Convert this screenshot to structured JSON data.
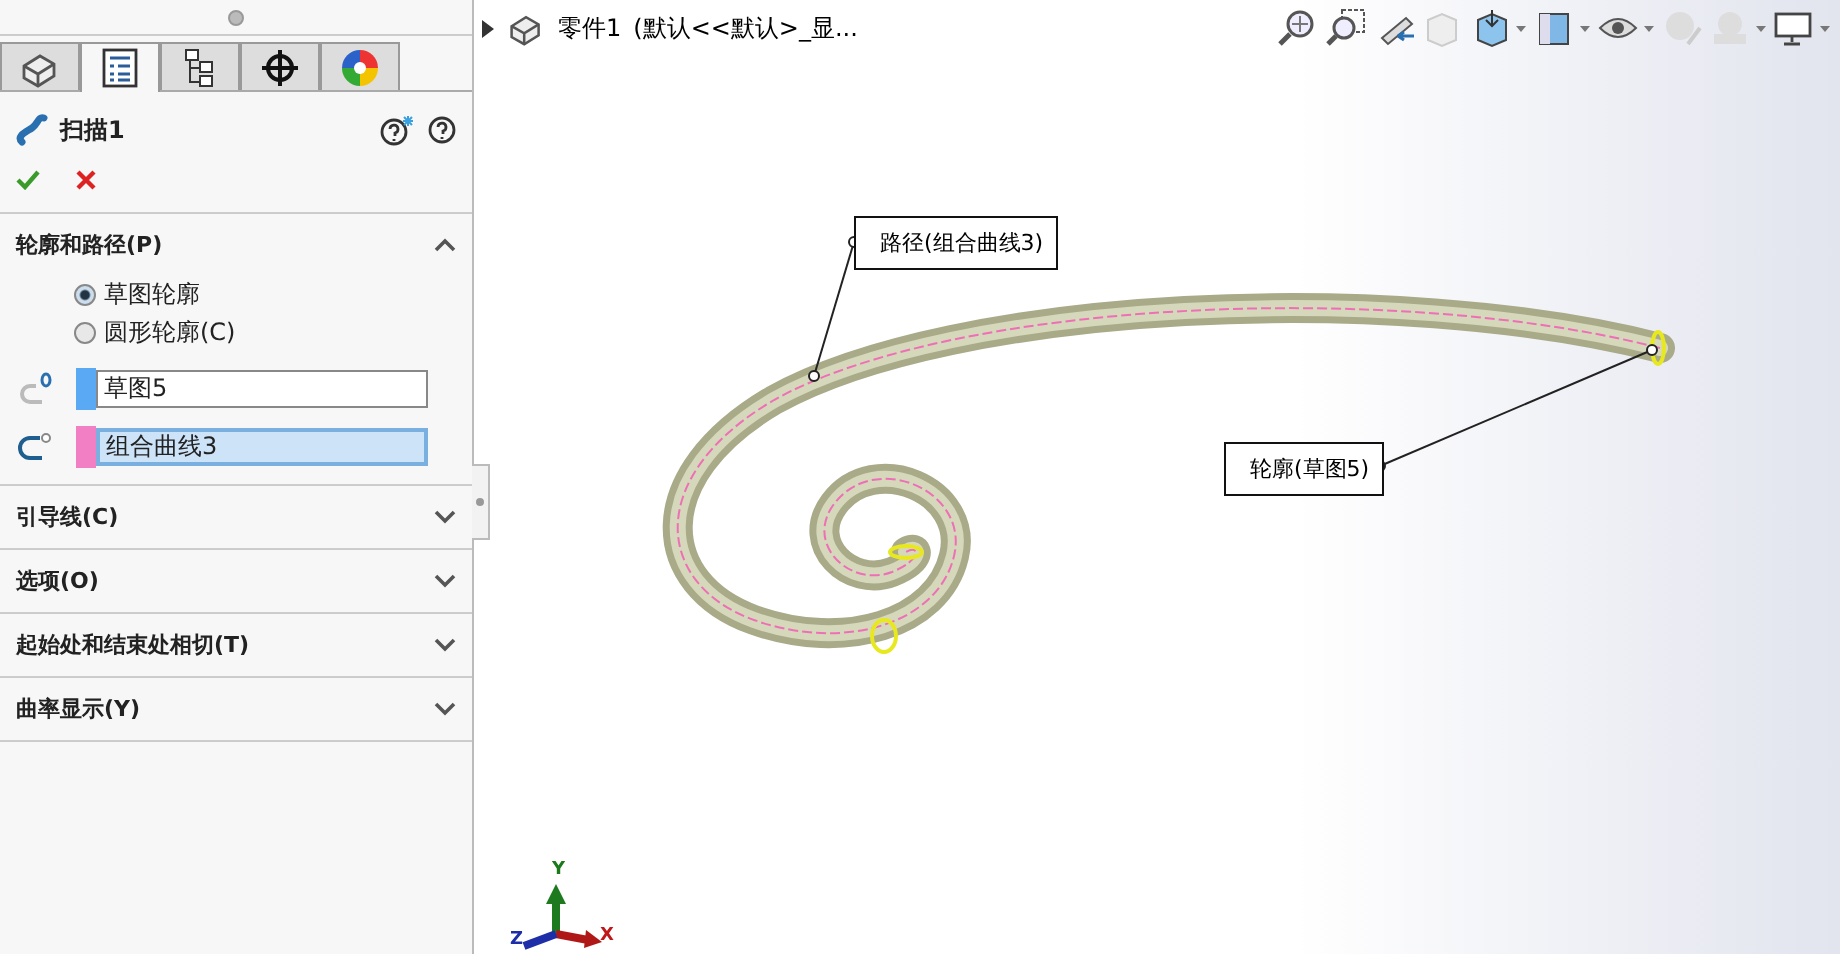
{
  "property_manager": {
    "tabs": [
      {
        "selected": false
      },
      {
        "selected": true
      },
      {
        "selected": false
      },
      {
        "selected": false
      },
      {
        "selected": false
      }
    ],
    "feature_title": "扫描1",
    "sections": [
      {
        "title": "轮廓和路径(P)",
        "expanded": true
      },
      {
        "title": "引导线(C)",
        "expanded": false
      },
      {
        "title": "选项(O)",
        "expanded": false
      },
      {
        "title": "起始处和结束处相切(T)",
        "expanded": false
      },
      {
        "title": "曲率显示(Y)",
        "expanded": false
      }
    ],
    "profile_options": [
      {
        "label": "草图轮廓",
        "selected": true
      },
      {
        "label": "圆形轮廓(C)",
        "selected": false
      }
    ],
    "fields": [
      {
        "value": "草图5",
        "color": "#5aa9f5",
        "selected": false
      },
      {
        "value": "组合曲线3",
        "color": "#f27fc3",
        "selected": true
      }
    ]
  },
  "viewport": {
    "breadcrumb": {
      "part": "零件1",
      "config": "(默认<<默认>_显..."
    },
    "callouts": [
      {
        "text": "路径(组合曲线3)"
      },
      {
        "text": "轮廓(草图5)"
      }
    ],
    "axes": [
      {
        "label": "Y"
      },
      {
        "label": "Z"
      },
      {
        "label": "X"
      }
    ]
  }
}
